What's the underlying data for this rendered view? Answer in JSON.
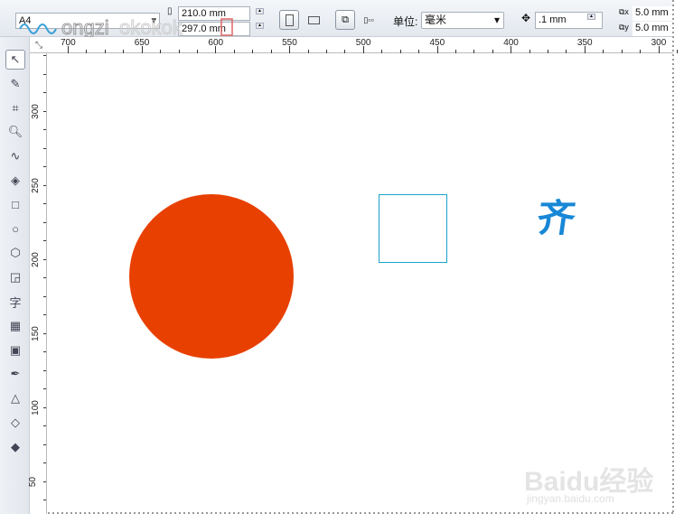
{
  "toolbar": {
    "page_size": "A4",
    "width": "210.0 mm",
    "height": "297.0 mm",
    "unit_label": "单位:",
    "unit_value": "毫米",
    "nudge": ".1 mm",
    "dup_x": "5.0 mm",
    "dup_y": "5.0 mm"
  },
  "watermark_logo": "wongziokokok",
  "ruler_top": [
    "700",
    "650",
    "600",
    "550",
    "500",
    "450",
    "400",
    "350",
    "300"
  ],
  "ruler_left": [
    "300",
    "250",
    "200",
    "150",
    "100",
    "50"
  ],
  "tools": [
    "pick-tool",
    "shape-tool",
    "crop-tool",
    "zoom-tool",
    "freehand-tool",
    "smart-fill-tool",
    "rectangle-tool",
    "ellipse-tool",
    "polygon-tool",
    "basic-shapes-tool",
    "text-tool",
    "table-tool",
    "interactive-blend-tool",
    "eyedropper-tool",
    "outline-tool",
    "fill-tool",
    "interactive-fill-tool"
  ],
  "text_tool_glyph": "字",
  "canvas": {
    "circle_color": "#e84000",
    "square_color": "#1aa3c8",
    "glyph_text": "齐",
    "glyph_color": "#1787d6"
  },
  "baidu_watermark": {
    "brand": "Baidu经验",
    "url": "jingyan.baidu.com"
  }
}
